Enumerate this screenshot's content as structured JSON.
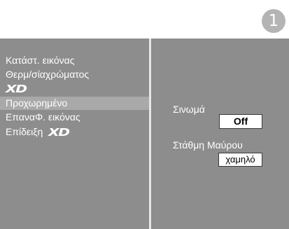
{
  "step_badge": "1",
  "menu": {
    "items": [
      {
        "label": "Κατάστ. εικόνας"
      },
      {
        "label": "Θερμ/σίαχρώματος"
      },
      {
        "label": "",
        "logo": "XD"
      },
      {
        "label": "Προχωρημένο",
        "selected": true
      },
      {
        "label": "ΕπαναΦ. εικόνας"
      },
      {
        "label": "Επίδειξη",
        "logo": "XD"
      }
    ]
  },
  "options": {
    "noise": {
      "label": "Σινωμά",
      "value": "Off"
    },
    "black_level": {
      "label": "Στάθμη  Μαύρου",
      "value": "χαμηλό"
    }
  },
  "colors": {
    "panel": "#8d8d8d",
    "selected": "#a9a9a9",
    "badge": "#b4b4b4"
  }
}
